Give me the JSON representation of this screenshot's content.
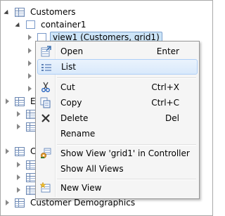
{
  "tree": {
    "root_label": "Customers",
    "container_label": "container1",
    "selected_view_label": "view1 (Customers, grid1)",
    "partial_e": "En",
    "partial_c": "C",
    "bottom_label": "Customer Demographics"
  },
  "menu": {
    "items": [
      {
        "label": "Open",
        "shortcut": "Enter",
        "icon": "open-icon"
      },
      {
        "label": "List",
        "shortcut": "",
        "icon": "list-icon"
      },
      {
        "label": "Cut",
        "shortcut": "Ctrl+X",
        "icon": "scissors-icon"
      },
      {
        "label": "Copy",
        "shortcut": "Ctrl+C",
        "icon": "copy-icon"
      },
      {
        "label": "Delete",
        "shortcut": "Del",
        "icon": "delete-icon"
      },
      {
        "label": "Rename",
        "shortcut": "",
        "icon": ""
      },
      {
        "label": "Show View 'grid1' in Controller",
        "shortcut": "",
        "icon": "show-view-icon"
      },
      {
        "label": "Show All Views",
        "shortcut": "",
        "icon": ""
      },
      {
        "label": "New View",
        "shortcut": "",
        "icon": "new-view-icon"
      }
    ]
  }
}
